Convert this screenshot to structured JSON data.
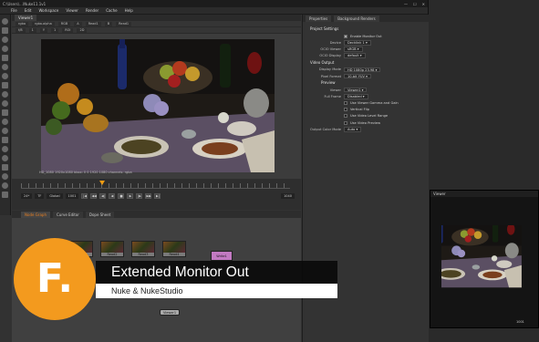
{
  "app": {
    "title": "C:\\Users\\...\\Nuke11.1v1",
    "window_buttons": [
      "—",
      "☐",
      "✕"
    ],
    "menu": [
      "File",
      "Edit",
      "Workspace",
      "Viewer",
      "Render",
      "Cache",
      "Help"
    ]
  },
  "viewer": {
    "tab": "Viewer1",
    "controls_row1": [
      "rgba",
      "rgba.alpha",
      "RGB",
      "A",
      "Read1",
      "B",
      "Read1"
    ],
    "controls_row2": [
      "f/8",
      "1",
      "Y",
      "1",
      "ROI",
      "2D"
    ],
    "status": "HD_1080 1920x1080  bbox: 0 0 1920 1080  channels: rgba",
    "frame_num": "1001"
  },
  "timeline": {
    "fps_label": "24*",
    "tf_label": "TF",
    "global_label": "Global",
    "frame_field": "1001",
    "end_frame": "1040",
    "buttons": [
      "|◀",
      "◀◀",
      "◀|",
      "◀",
      "■",
      "▶",
      "|▶",
      "▶▶",
      "▶|"
    ]
  },
  "nodegraph": {
    "tabs": [
      {
        "label": "Node Graph",
        "active": true
      },
      {
        "label": "Curve Editor",
        "active": false
      },
      {
        "label": "Dope Sheet",
        "active": false
      }
    ],
    "nodes": [
      "Read1",
      "Read2",
      "Read3",
      "Read4"
    ],
    "write_node": "Write1",
    "viewer_node": "Viewer1"
  },
  "properties": {
    "tabs": [
      "Properties",
      "Background Renders"
    ],
    "header": "Project Settings",
    "rows": [
      {
        "type": "check",
        "label": "",
        "value": "Enable Monitor Out",
        "on": true
      },
      {
        "type": "field",
        "label": "Device",
        "value": "Decklink 1 ▾"
      },
      {
        "type": "field",
        "label": "OCIO Viewer",
        "value": "sRGB ▾"
      },
      {
        "type": "field",
        "label": "OCIO Display",
        "value": "default ▾"
      },
      {
        "type": "section",
        "label": "Video Output"
      },
      {
        "type": "field",
        "label": "Display Mode",
        "value": "HD 1080p 23.98 ▾"
      },
      {
        "type": "field",
        "label": "Pixel Format",
        "value": "10-bit YUV ▾"
      },
      {
        "type": "subsection",
        "label": "Preview"
      },
      {
        "type": "field",
        "label": "Viewer",
        "value": "Viewer1 ▾"
      },
      {
        "type": "field",
        "label": "Full Frame",
        "value": "Disabled ▾"
      },
      {
        "type": "check",
        "label": "",
        "value": "Use Viewer Gamma and Gain",
        "on": false
      },
      {
        "type": "check",
        "label": "",
        "value": "Vertical Flip",
        "on": false
      },
      {
        "type": "check",
        "label": "",
        "value": "Use Video Level Range",
        "on": false
      },
      {
        "type": "check",
        "label": "",
        "value": "Use Video Preview",
        "on": false
      },
      {
        "type": "field",
        "label": "Output Color Mode",
        "value": "Auto ▾"
      }
    ]
  },
  "ext_monitor": {
    "title": "Viewer",
    "frame_num": "1001"
  },
  "overlay": {
    "logo_letter": "F.",
    "title": "Extended Monitor Out",
    "subtitle": "Nuke & NukeStudio"
  },
  "colors": {
    "accent": "#f39a1e",
    "write_node": "#c27ac2"
  }
}
